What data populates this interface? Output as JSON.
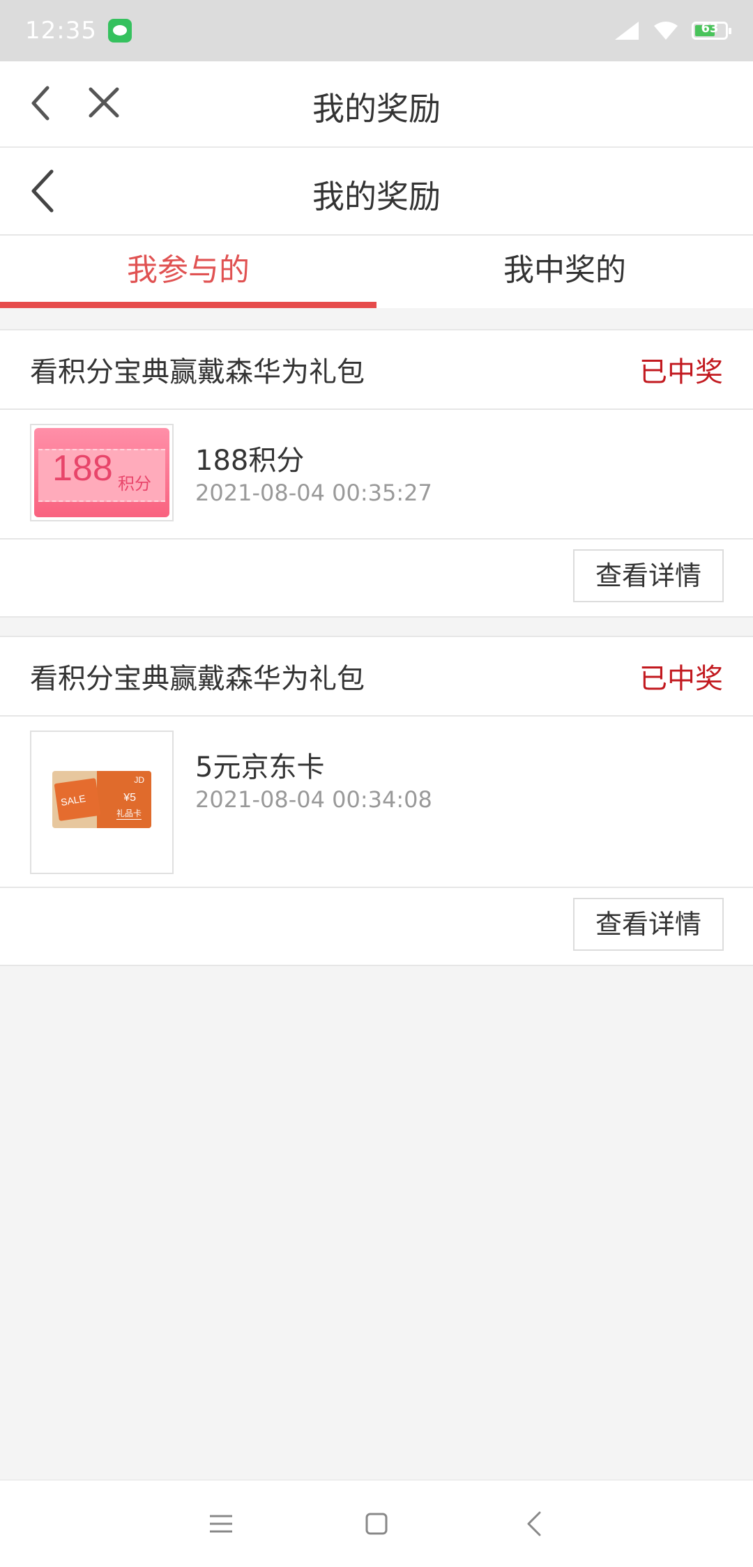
{
  "status_bar": {
    "time": "12:35",
    "battery_level": "63",
    "icons": [
      "wechat-icon",
      "signal-icon",
      "wifi-icon",
      "battery-icon"
    ]
  },
  "browser_bar": {
    "title": "我的奖励",
    "icons": [
      "back-icon",
      "close-icon"
    ]
  },
  "page_header": {
    "title": "我的奖励",
    "icons": [
      "back-icon"
    ]
  },
  "tabs": [
    {
      "label": "我参与的",
      "active": true
    },
    {
      "label": "我中奖的",
      "active": false
    }
  ],
  "rewards": [
    {
      "activity": "看积分宝典赢戴森华为礼包",
      "status": "已中奖",
      "prize_name": "188积分",
      "time": "2021-08-04 00:35:27",
      "thumb_text": "188",
      "thumb_unit": "积分",
      "button": "查看详情"
    },
    {
      "activity": "看积分宝典赢戴森华为礼包",
      "status": "已中奖",
      "prize_name": "5元京东卡",
      "time": "2021-08-04 00:34:08",
      "thumb_bag_text": "SALE",
      "thumb_brand": "JD",
      "thumb_value": "¥5",
      "thumb_label": "礼品卡",
      "button": "查看详情"
    }
  ],
  "colors": {
    "accent": "#e05252",
    "status_red": "#c2191f",
    "background": "#f4f4f4"
  },
  "nav_bar": {
    "icons": [
      "menu-icon",
      "home-icon",
      "back-nav-icon"
    ]
  }
}
